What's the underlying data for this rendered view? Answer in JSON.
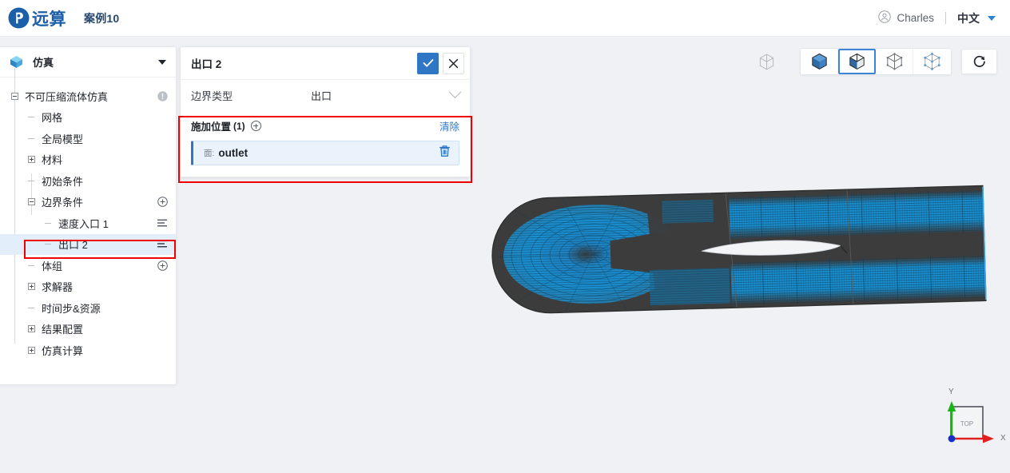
{
  "topbar": {
    "brand": "远算",
    "case_name": "案例10",
    "user": "Charles",
    "language": "中文",
    "icons": {
      "logo": "yuansuan-logo-icon",
      "user": "user-avatar-icon",
      "caret": "caret-down-icon"
    }
  },
  "sidebar": {
    "header": {
      "label": "仿真",
      "icon": "cube-icon",
      "caret": "caret-down-icon"
    },
    "items": [
      {
        "label": "不可压缩流体仿真",
        "toggle": "minus",
        "depth": 0,
        "right_icon": "warning-circle-icon",
        "selected": false
      },
      {
        "label": "网格",
        "toggle": "stub",
        "depth": 1,
        "right_icon": "",
        "selected": false
      },
      {
        "label": "全局模型",
        "toggle": "stub",
        "depth": 1,
        "right_icon": "",
        "selected": false
      },
      {
        "label": "材料",
        "toggle": "plus",
        "depth": 1,
        "right_icon": "",
        "selected": false
      },
      {
        "label": "初始条件",
        "toggle": "stub",
        "depth": 1,
        "right_icon": "",
        "selected": false
      },
      {
        "label": "边界条件",
        "toggle": "minus",
        "depth": 1,
        "right_icon": "plus-circle-icon",
        "selected": false
      },
      {
        "label": "速度入口 1",
        "toggle": "stub",
        "depth": 2,
        "right_icon": "list-icon",
        "selected": false
      },
      {
        "label": "出口 2",
        "toggle": "stub",
        "depth": 2,
        "right_icon": "list-icon",
        "selected": true
      },
      {
        "label": "体组",
        "toggle": "stub",
        "depth": 1,
        "right_icon": "plus-circle-icon",
        "selected": false
      },
      {
        "label": "求解器",
        "toggle": "plus",
        "depth": 1,
        "right_icon": "",
        "selected": false
      },
      {
        "label": "时间步&资源",
        "toggle": "stub",
        "depth": 1,
        "right_icon": "",
        "selected": false
      },
      {
        "label": "结果配置",
        "toggle": "plus",
        "depth": 1,
        "right_icon": "",
        "selected": false
      },
      {
        "label": "仿真计算",
        "toggle": "plus",
        "depth": 1,
        "right_icon": "",
        "selected": false
      }
    ]
  },
  "properties": {
    "title": "出口 2",
    "confirm_icon": "check-icon",
    "cancel_icon": "close-icon",
    "boundary_type": {
      "label": "边界类型",
      "value": "出口",
      "caret": "chevron-down-icon"
    },
    "location": {
      "label": "施加位置",
      "count": "(1)",
      "add_icon": "plus-circle-icon",
      "clear_label": "清除",
      "item": {
        "kind": "面:",
        "name": "outlet",
        "delete_icon": "trash-icon"
      }
    }
  },
  "viewport_toolbar": {
    "buttons": [
      {
        "name": "wireframe-outline-cube-icon",
        "active": false,
        "group": "standalone"
      },
      {
        "name": "solid-cube-icon",
        "active": false,
        "group": "main"
      },
      {
        "name": "solid-edges-cube-icon",
        "active": true,
        "group": "main"
      },
      {
        "name": "wireframe-cube-icon",
        "active": false,
        "group": "main"
      },
      {
        "name": "points-cube-icon",
        "active": false,
        "group": "main"
      },
      {
        "name": "reset-view-icon",
        "active": false,
        "group": "single"
      }
    ]
  },
  "axis_triad": {
    "x_label": "X",
    "y_label": "Y",
    "face_label": "TOP",
    "x_color": "#e02020",
    "y_color": "#17b317",
    "origin_color": "#1530c8"
  },
  "model": {
    "name": "airfoil-cfd-mesh",
    "shell_color": "#3c3c3c",
    "mesh_color": "#1a8fd0",
    "airfoil_color": "#f2f4f6"
  },
  "colors": {
    "accent": "#2f76c4",
    "brand": "#1b5fa8",
    "annotation": "#f10000",
    "background": "#eff1f5",
    "selected_row": "#e3eefb"
  }
}
